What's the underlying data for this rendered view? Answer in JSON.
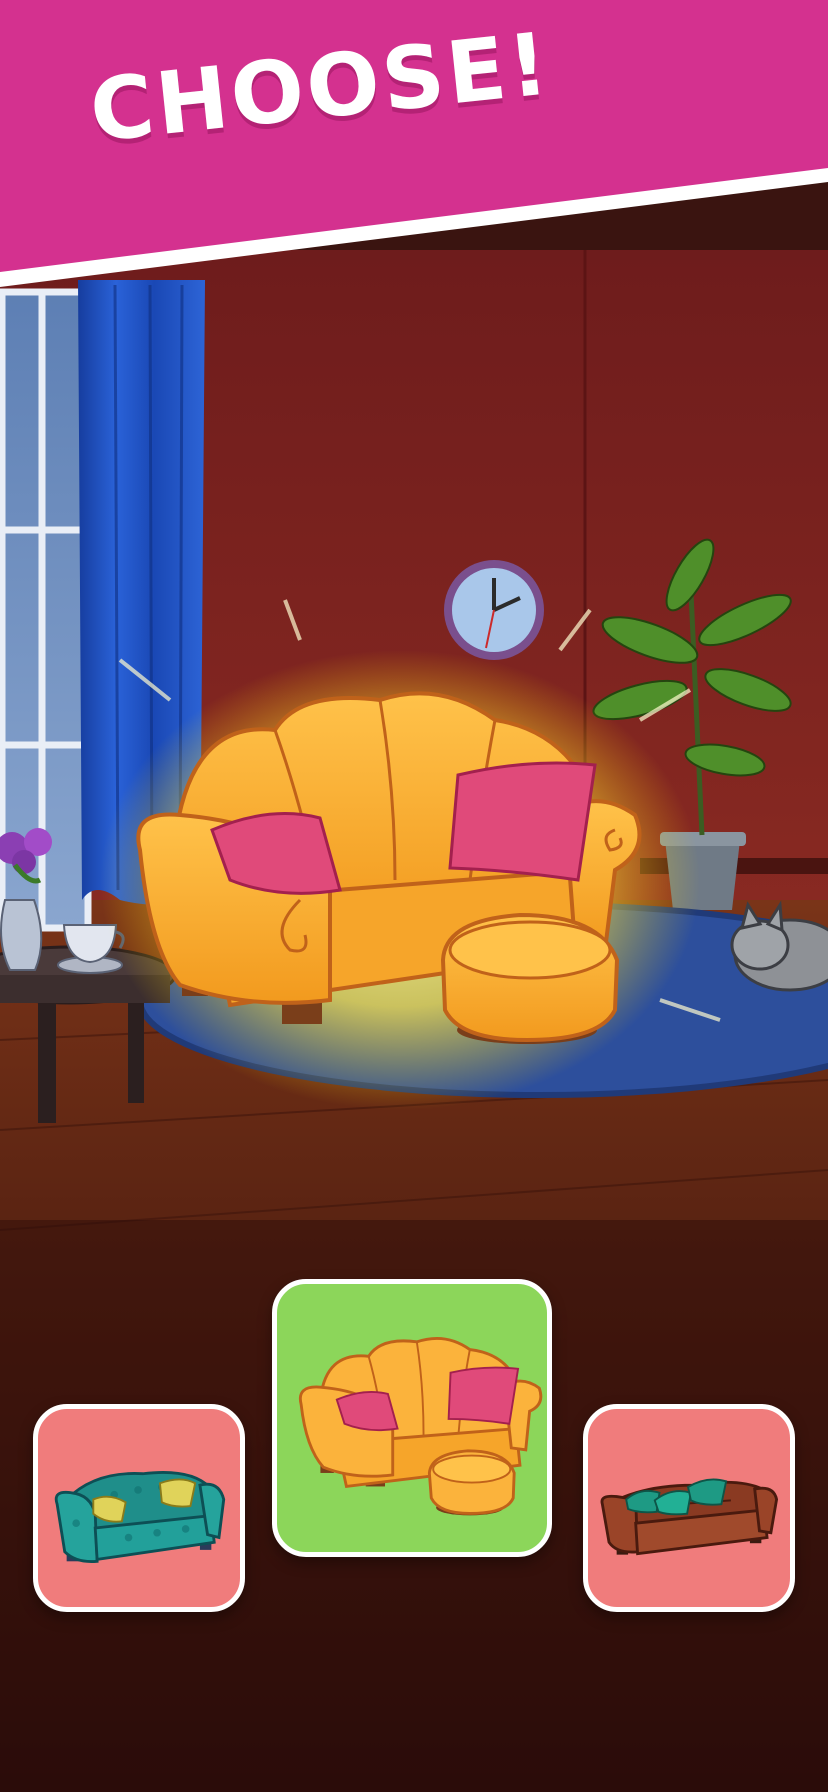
{
  "banner": {
    "title": "CHOOSE!",
    "color": "#d4318f"
  },
  "scene": {
    "wall_color": "#7a2020",
    "floor_color": "#6b2a14",
    "rug_color": "#2f5aa8",
    "curtain_color": "#1e4fbf",
    "highlighted_item": "sofa-orange-icon"
  },
  "options": [
    {
      "name": "teal-patterned-sofa",
      "icon": "sofa-teal-icon",
      "card_color": "#f07c7c",
      "selected": false
    },
    {
      "name": "orange-shell-sofa",
      "icon": "sofa-orange-icon",
      "card_color": "#8cd65a",
      "selected": true
    },
    {
      "name": "brown-leather-sofa",
      "icon": "sofa-brown-icon",
      "card_color": "#f07c7c",
      "selected": false
    }
  ]
}
